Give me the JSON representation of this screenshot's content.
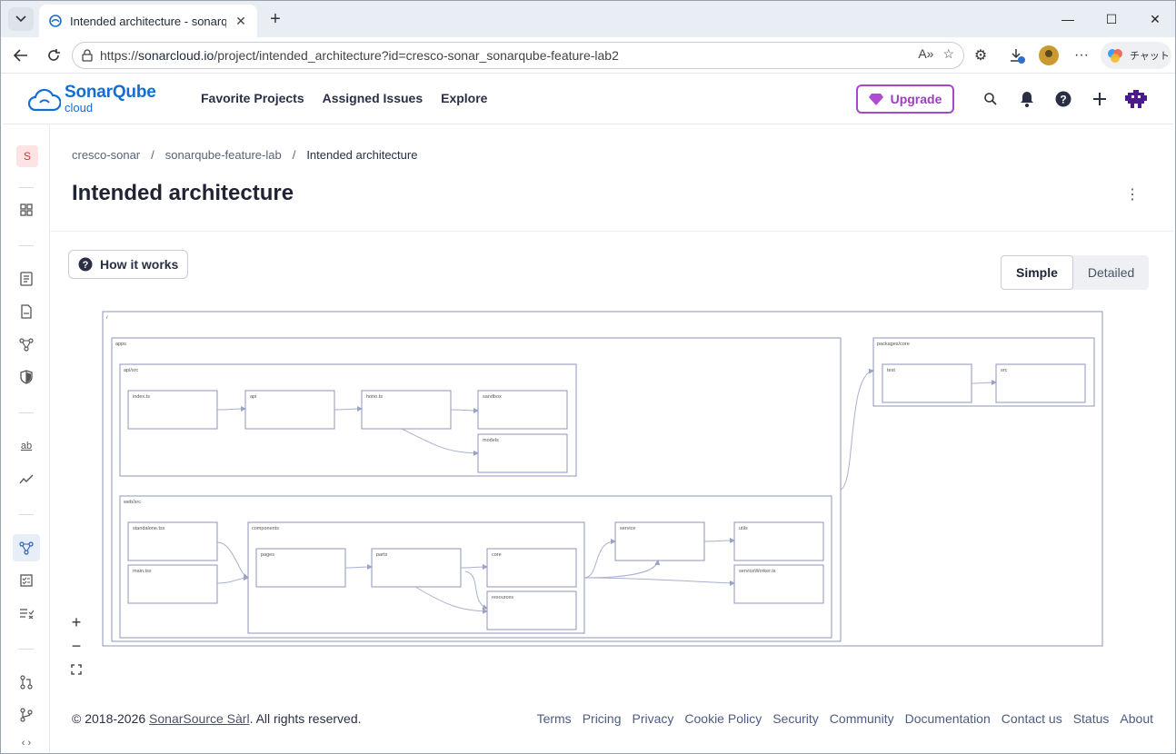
{
  "browser": {
    "tab_title": "Intended architecture - sonarqube-",
    "url_scheme": "https://",
    "url_host": "sonarcloud.io",
    "url_path": "/project/intended_architecture?id=cresco-sonar_sonarqube-feature-lab2",
    "copilot_label": "チャット",
    "download_badge": "1"
  },
  "app": {
    "logo_main": "SonarQube",
    "logo_sub": "cloud",
    "nav": [
      "Favorite Projects",
      "Assigned Issues",
      "Explore"
    ],
    "upgrade_label": "Upgrade",
    "org_initial": "S"
  },
  "breadcrumb": {
    "org": "cresco-sonar",
    "project": "sonarqube-feature-lab",
    "page": "Intended architecture",
    "sep": "/"
  },
  "page": {
    "title": "Intended architecture",
    "how_it_works": "How it works",
    "view_simple": "Simple",
    "view_detailed": "Detailed"
  },
  "diagram": {
    "root": "/",
    "groups": {
      "apps": "apps",
      "api_src": "api/src",
      "web_src": "web/src",
      "components": "components",
      "packages_core": "packages/core"
    },
    "nodes": {
      "index": "index.ts",
      "api": "api",
      "hono": "hono.ts",
      "sandbox": "sandbox",
      "models": "models",
      "standalone": "standalone.tsx",
      "main": "main.tsx",
      "pages": "pages",
      "parts": "parts",
      "core": "core",
      "resources": "resources",
      "service": "service",
      "utils": "utils",
      "serviceworker": "serviceWorker.ts",
      "test": "test",
      "src": "src"
    }
  },
  "footer": {
    "copyright_prefix": "© 2018-2026",
    "company": "SonarSource Sàrl",
    "copyright_suffix": ". All rights reserved.",
    "links": [
      "Terms",
      "Pricing",
      "Privacy",
      "Cookie Policy",
      "Security",
      "Community",
      "Documentation",
      "Contact us",
      "Status",
      "About"
    ]
  }
}
